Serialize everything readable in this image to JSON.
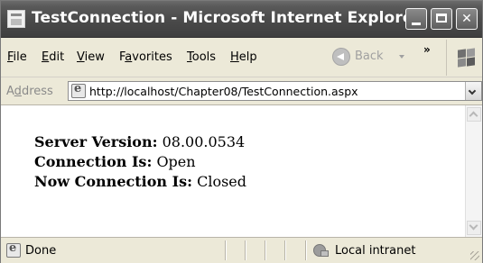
{
  "window": {
    "title": "TestConnection - Microsoft Internet Explorer",
    "controls": [
      "minimize-icon",
      "maximize-icon",
      "close-icon"
    ]
  },
  "menu": {
    "items": [
      {
        "pre": "",
        "key": "F",
        "post": "ile"
      },
      {
        "pre": "",
        "key": "E",
        "post": "dit"
      },
      {
        "pre": "",
        "key": "V",
        "post": "iew"
      },
      {
        "pre": "F",
        "key": "a",
        "post": "vorites"
      },
      {
        "pre": "",
        "key": "T",
        "post": "ools"
      },
      {
        "pre": "",
        "key": "H",
        "post": "elp"
      }
    ],
    "back_label": "Back",
    "overflow": "»"
  },
  "address": {
    "label_pre": "A",
    "label_key": "d",
    "label_post": "dress",
    "url": "http://localhost/Chapter08/TestConnection.aspx"
  },
  "content": {
    "lines": [
      {
        "label": "Server Version",
        "value": "08.00.0534"
      },
      {
        "label": "Connection Is",
        "value": "Open"
      },
      {
        "label": "Now Connection Is",
        "value": "Closed"
      }
    ]
  },
  "status": {
    "text": "Done",
    "zone": "Local intranet"
  }
}
